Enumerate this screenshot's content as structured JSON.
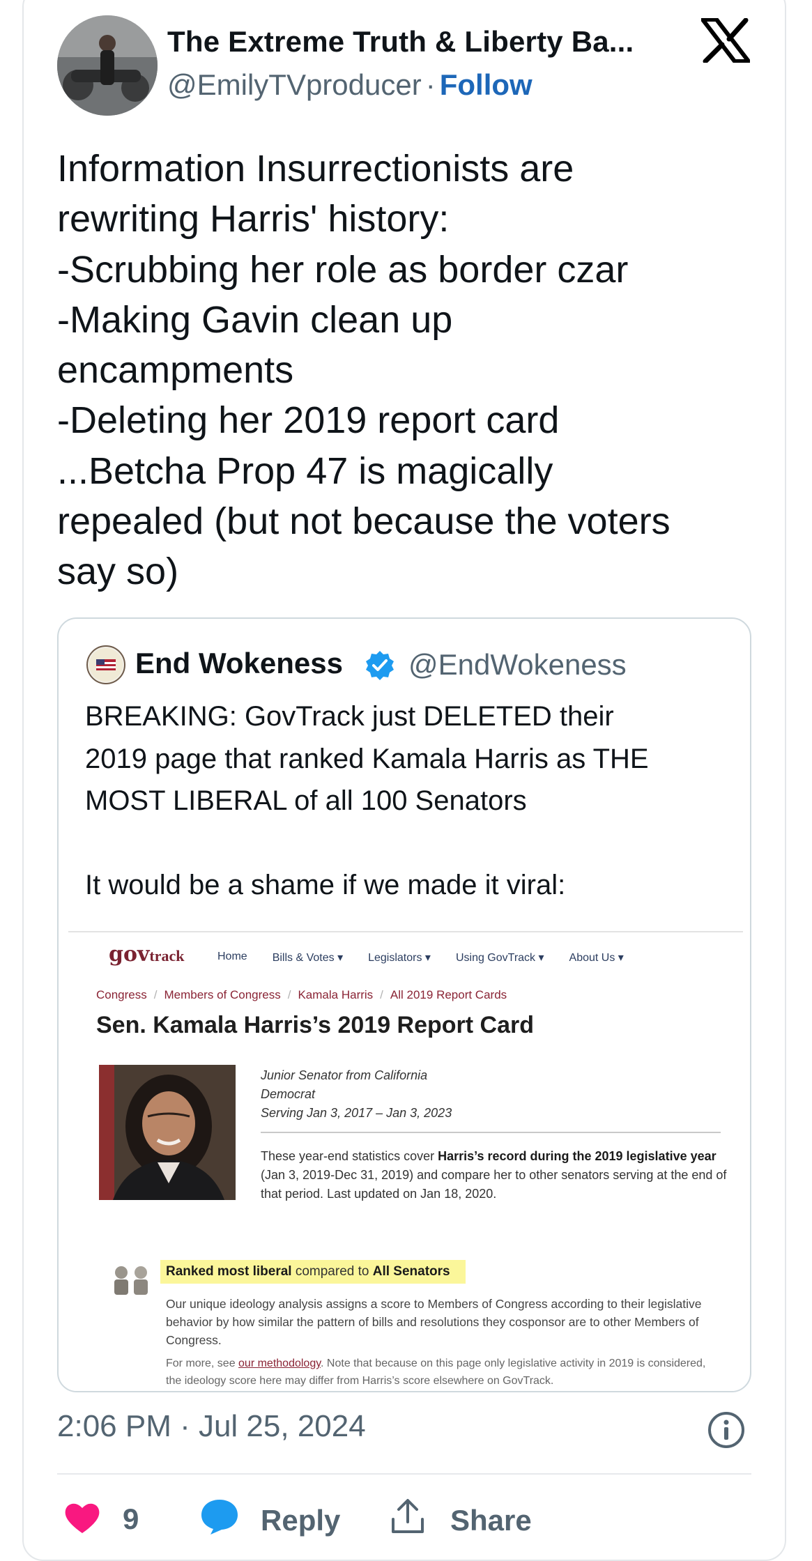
{
  "post": {
    "author_name": "The Extreme Truth & Liberty Ba...",
    "author_handle": "@EmilyTVproducer",
    "separator": "·",
    "follow_label": "Follow",
    "text": "Information Insurrectionists are\nrewriting Harris' history:\n-Scrubbing her role as  border czar\n-Making Gavin clean up\nencampments\n-Deleting her 2019 report card\n...Betcha Prop 47 is magically\nrepealed (but not because the voters\nsay so)",
    "timestamp": "2:06 PM · Jul 25, 2024",
    "like_count": "9",
    "reply_label": "Reply",
    "share_label": "Share"
  },
  "quoted": {
    "author_name": "End Wokeness",
    "author_handle": "@EndWokeness",
    "text": "BREAKING: GovTrack just DELETED their\n2019 page that ranked Kamala Harris as THE\nMOST LIBERAL of all 100 Senators\n\nIt would be a shame if we made it viral:",
    "screenshot": {
      "logo_gov": "gov",
      "logo_track": "track",
      "nav": [
        "Home",
        "Bills & Votes ▾",
        "Legislators ▾",
        "Using GovTrack ▾",
        "About Us ▾"
      ],
      "breadcrumbs": [
        "Congress",
        "Members of Congress",
        "Kamala Harris",
        "All 2019 Report Cards"
      ],
      "breadcrumb_sep": "/",
      "title": "Sen. Kamala Harris’s 2019 Report Card",
      "info": "Junior Senator from California\nDemocrat\nServing Jan 3, 2017 – Jan 3, 2023",
      "para_before": "These year-end statistics cover ",
      "para_bold": "Harris’s record during the 2019 legislative year",
      "para_after": " (Jan 3, 2019-Dec 31, 2019) and compare her to other senators serving at the end of that period. Last updated on Jan 18, 2020.",
      "rank_bold1": "Ranked most liberal",
      "rank_mid": " compared to ",
      "rank_bold2": "All Senators",
      "desc": "Our unique ideology analysis assigns a score to Members of Congress according to their legislative behavior by how similar the pattern of bills and resolutions they cosponsor are to other Members of Congress.",
      "more_before": "For more, see ",
      "more_link": "our methodology",
      "more_after": ". Note that because on this page only legislative activity in 2019 is considered, the ideology score here may differ from Harris’s score elsewhere on GovTrack."
    }
  },
  "colors": {
    "accent_blue": "#1d9bf0",
    "like_pink": "#f91880",
    "muted": "#536471",
    "govtrack_red": "#8a2435",
    "highlight": "#fbf69a"
  },
  "icons": [
    "x-logo-icon",
    "verified-badge-icon",
    "info-icon",
    "heart-icon",
    "reply-bubble-icon",
    "share-icon"
  ]
}
